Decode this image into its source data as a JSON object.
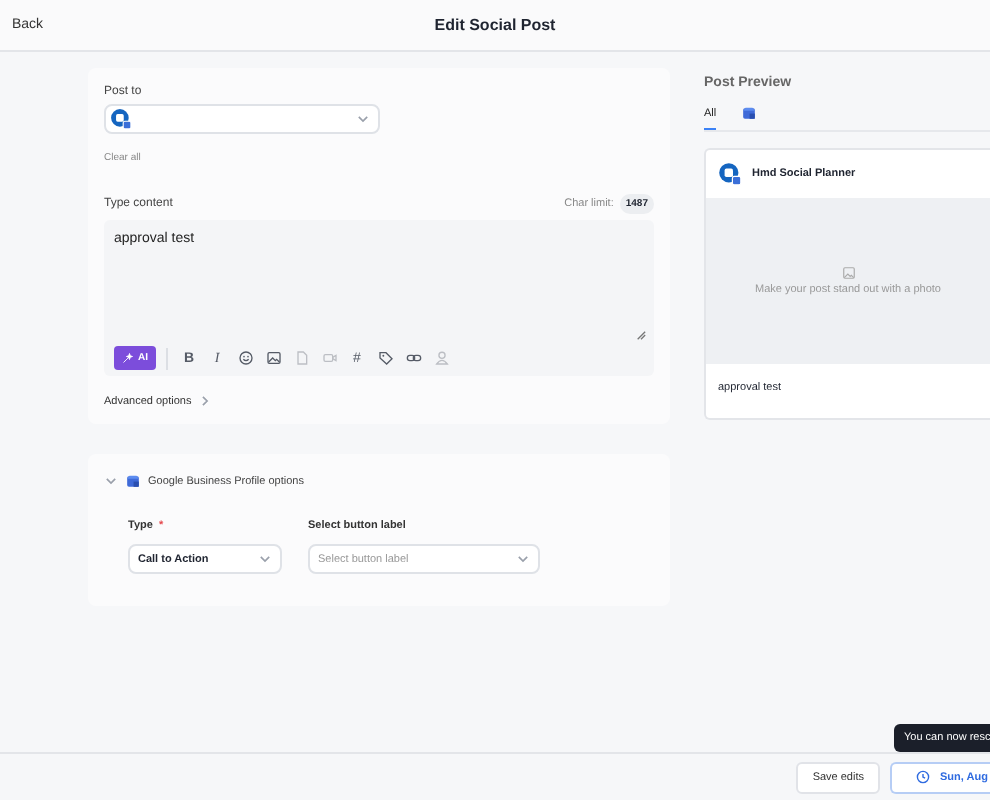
{
  "header": {
    "back": "Back",
    "title": "Edit Social Post"
  },
  "post_to": {
    "label": "Post to",
    "clear": "Clear all"
  },
  "content": {
    "label": "Type content",
    "char_limit_label": "Char limit:",
    "char_limit": "1487",
    "value": "approval test"
  },
  "toolbar": [
    {
      "kind": "ai",
      "label": "AI",
      "disabled": false
    },
    {
      "kind": "bold",
      "label": "B",
      "disabled": false
    },
    {
      "kind": "italic",
      "label": "I",
      "disabled": false
    },
    {
      "kind": "emoji",
      "disabled": false
    },
    {
      "kind": "image",
      "disabled": false
    },
    {
      "kind": "file",
      "disabled": true
    },
    {
      "kind": "video",
      "disabled": true
    },
    {
      "kind": "hashtag",
      "label": "#",
      "disabled": false
    },
    {
      "kind": "tag",
      "disabled": false
    },
    {
      "kind": "link",
      "disabled": false
    },
    {
      "kind": "person",
      "disabled": true
    }
  ],
  "advanced": "Advanced options",
  "gbp": {
    "title": "Google Business Profile options",
    "expanded": true,
    "fields": [
      {
        "label": "Type",
        "required_mark": "*",
        "value": "Call to Action"
      },
      {
        "label": "Select button label",
        "placeholder": "Select button label"
      }
    ]
  },
  "preview": {
    "title": "Post Preview",
    "tabs": [
      {
        "kind": "text",
        "label": "All",
        "selected": true
      },
      {
        "kind": "icon",
        "selected": false
      }
    ],
    "account": "Hmd Social Planner",
    "photo_hint": "Make your post stand out with a photo",
    "text": "approval test"
  },
  "footer": {
    "save": "Save edits",
    "schedule": "Sun, Aug",
    "tooltip": "You can now resc"
  }
}
